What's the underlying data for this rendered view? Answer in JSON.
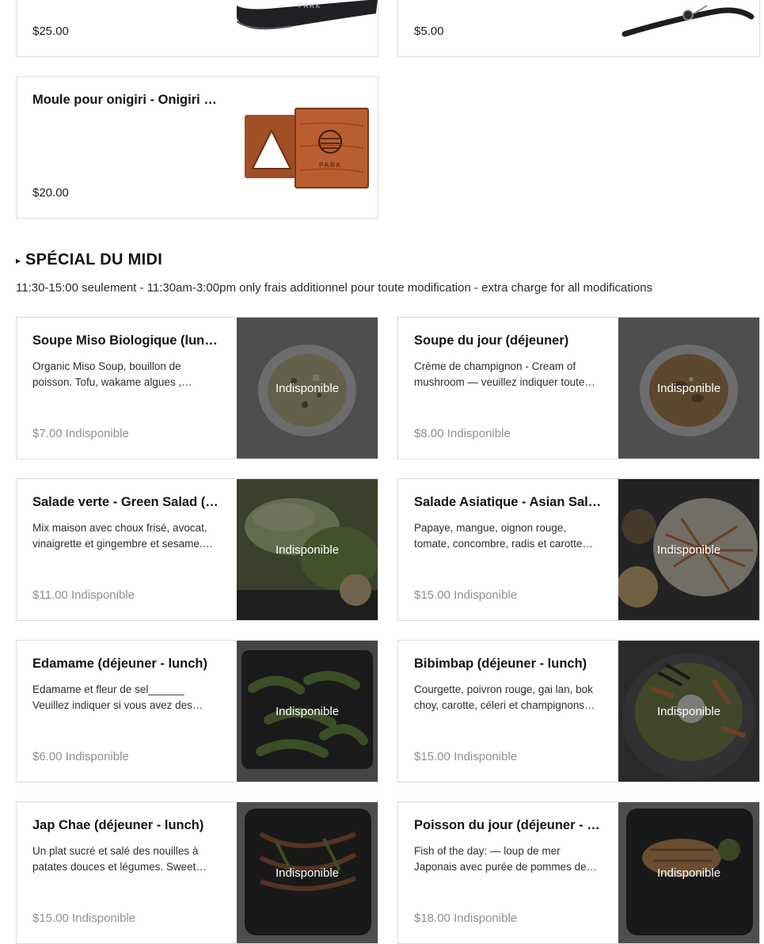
{
  "top_cards": [
    {
      "price": "$25.00",
      "image": "cap-photo"
    },
    {
      "price": "$5.00",
      "image": "strap-photo"
    }
  ],
  "onigiri_card": {
    "title": "Moule pour onigiri - Onigiri mold",
    "price": "$20.00",
    "image": "onigiri-mold-photo"
  },
  "section": {
    "title": "SPÉCIAL DU MIDI",
    "description": "11:30-15:00 seulement - 11:30am-3:00pm only frais additionnel pour toute modification - extra charge for all modifications"
  },
  "unavailable_label": "Indisponible",
  "items": [
    {
      "title": "Soupe Miso Biologique (lunch)",
      "description": "Organic Miso Soup, bouillon de poisson. Tofu, wakame algues , oignons verts",
      "price": "$7.00",
      "status": "Indisponible",
      "overlay": "Indisponible"
    },
    {
      "title": "Soupe du jour (déjeuner)",
      "description": "Crème de champignon - Cream of mushroom — veuillez indiquer toute allergie",
      "price": "$8.00",
      "status": "Indisponible",
      "overlay": "Indisponible"
    },
    {
      "title": "Salade verte - Green Salad (déjeuner)",
      "description": "Mix maison avec choux frisé, avocat, vinaigrette et gingembre et sesame. Green salad",
      "price": "$11.00",
      "status": "Indisponible",
      "overlay": "Indisponible"
    },
    {
      "title": "Salade Asiatique - Asian Salad (déjeuner)",
      "description": "Papaye, mangue, oignon rouge, tomate, concombre, radis et carotte marinée",
      "price": "$15.00",
      "status": "Indisponible",
      "overlay": "Indisponible"
    },
    {
      "title": "Edamame (déjeuner - lunch)",
      "description": "Edamame et fleur de sel______ Veuillez indiquer si vous avez des allergies",
      "price": "$6.00",
      "status": "Indisponible",
      "overlay": "Indisponible"
    },
    {
      "title": "Bibimbap (déjeuner - lunch)",
      "description": "Courgette, poivron rouge, gai lan, bok choy, carotte, céleri et champignons shiitake",
      "price": "$15.00",
      "status": "Indisponible",
      "overlay": "Indisponible"
    },
    {
      "title": "Jap Chae (déjeuner - lunch)",
      "description": "Un plat sucré et salé des nouilles à patates douces et légumes. Sweet potato noodles",
      "price": "$15.00",
      "status": "Indisponible",
      "overlay": "Indisponible"
    },
    {
      "title": "Poisson du jour (déjeuner - lunch)",
      "description": "Fish of the day: — loup de mer Japonais avec purée de pommes de terre",
      "price": "$18.00",
      "status": "Indisponible",
      "overlay": "Indisponible"
    }
  ],
  "colors": {
    "accent": "#141414",
    "muted": "#8f8f8f",
    "border": "#dcdcdc",
    "overlay": "#1e1e1e"
  }
}
